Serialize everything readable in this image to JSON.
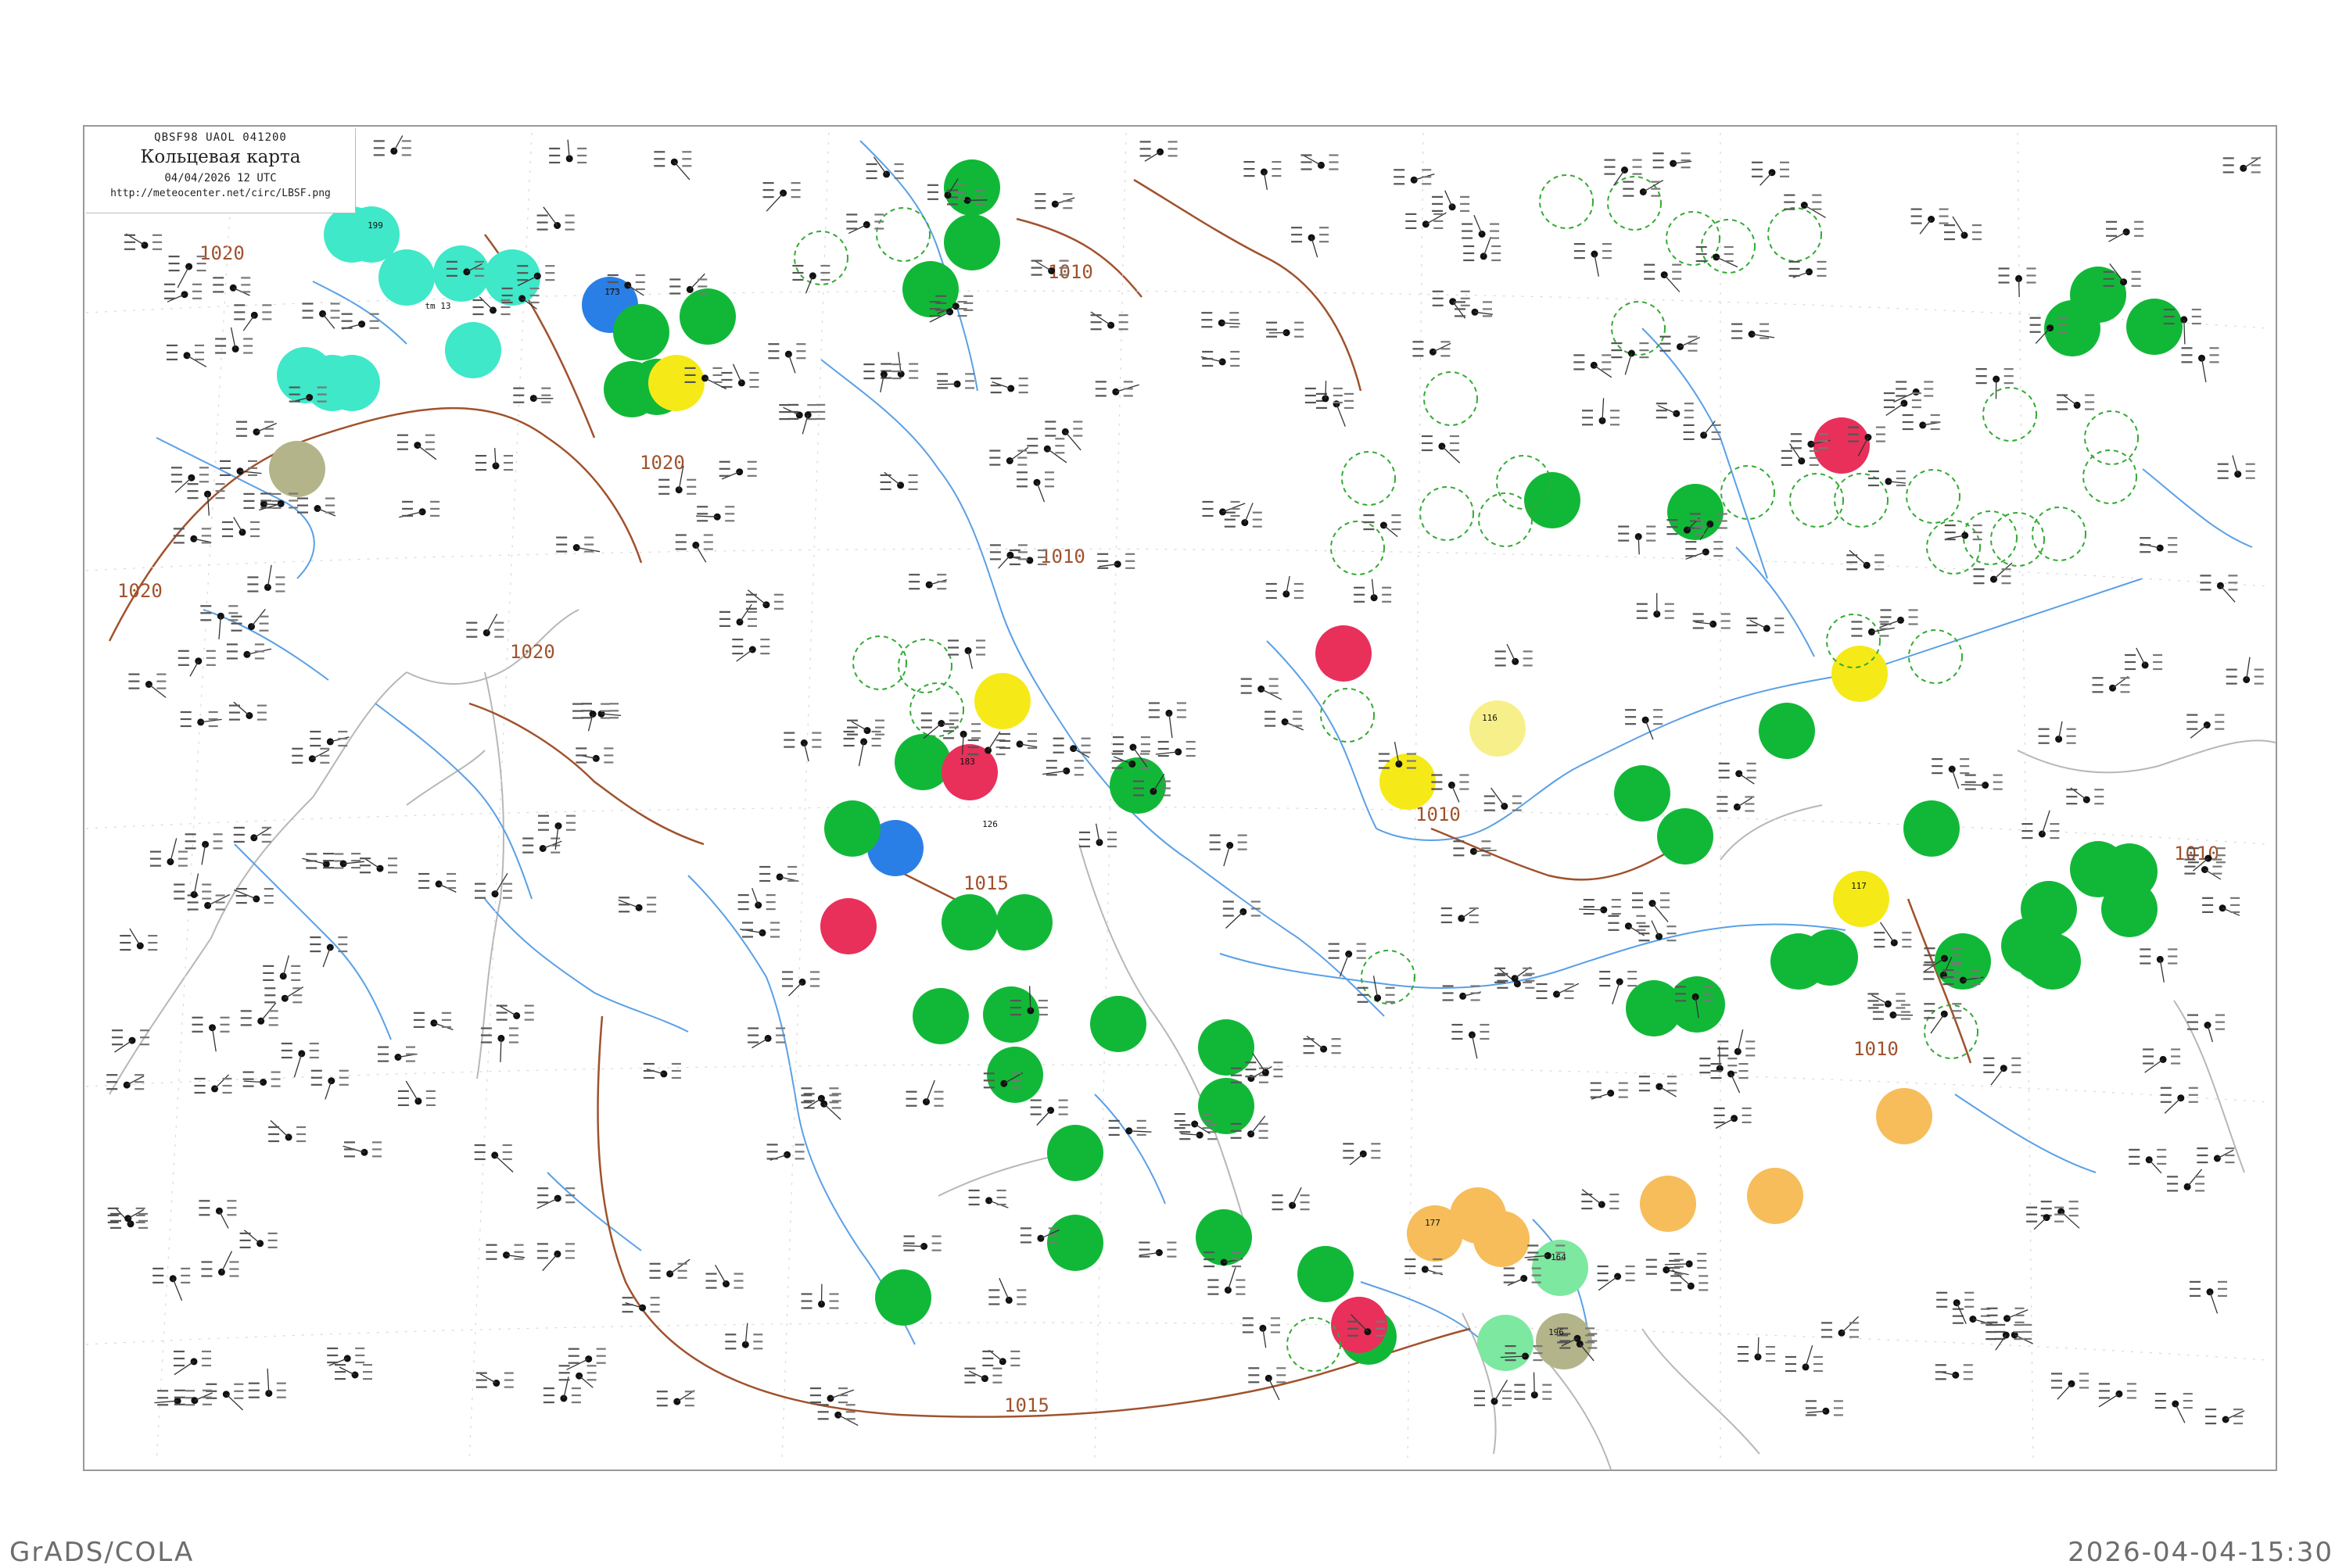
{
  "header": {
    "code_line": "QBSF98  UAOL  041200",
    "title": "Кольцевая карта",
    "datetime": "04/04/2026 12 UTC",
    "url": "http://meteocenter.net/circ/LBSF.png"
  },
  "footer": {
    "left": "GrADS/COLA",
    "right": "2026-04-04-15:30"
  },
  "colors": {
    "green": "#11b838",
    "teal": "#3ee8c8",
    "blue": "#2a7fe6",
    "red": "#e8305a",
    "yellow": "#f5ea18",
    "pale_yellow": "#f7f08a",
    "orange": "#f6bd5a",
    "olive": "#b4b48a",
    "light_green": "#7de8a0",
    "river": "#5aa0e6",
    "isobar": "#a0522d",
    "border": "#bbbbbb",
    "dashed_circle": "#33aa33"
  },
  "isobar_labels": [
    "1020",
    "1020",
    "1020",
    "1020",
    "1015",
    "1015",
    "1010",
    "1010",
    "1010",
    "1010",
    "1010"
  ],
  "station_clusters": [
    {
      "color": "green",
      "label": "tm 13"
    },
    {
      "color": "green",
      "label": "126"
    },
    {
      "color": "teal",
      "label": "199"
    },
    {
      "color": "blue",
      "label": "173"
    },
    {
      "color": "red",
      "label": "183"
    },
    {
      "color": "yellow",
      "label": "117"
    },
    {
      "color": "orange",
      "label": "177"
    },
    {
      "color": "olive",
      "label": "196"
    },
    {
      "color": "light_green",
      "label": "164"
    },
    {
      "color": "pale_yellow",
      "label": "116"
    }
  ]
}
